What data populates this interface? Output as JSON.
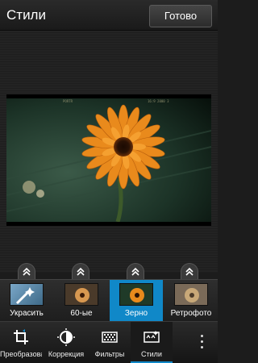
{
  "header": {
    "title": "Стили",
    "done_label": "Готово"
  },
  "photo": {
    "film_left": "PORTR",
    "film_right": "16:9  2000 3"
  },
  "styles": [
    {
      "label": "Украсить",
      "selected": false
    },
    {
      "label": "60-ые",
      "selected": false
    },
    {
      "label": "Зерно",
      "selected": true
    },
    {
      "label": "Ретрофото",
      "selected": false
    }
  ],
  "toolbar": [
    {
      "label": "Преобразова",
      "icon": "crop-rotate-icon"
    },
    {
      "label": "Коррекция",
      "icon": "adjust-icon"
    },
    {
      "label": "Фильтры",
      "icon": "filter-grid-icon"
    },
    {
      "label": "Стили",
      "icon": "styles-icon",
      "active": true
    }
  ],
  "colors": {
    "accent": "#1088c8",
    "flower": "#e98a1c",
    "background": "#1c1c1c"
  }
}
